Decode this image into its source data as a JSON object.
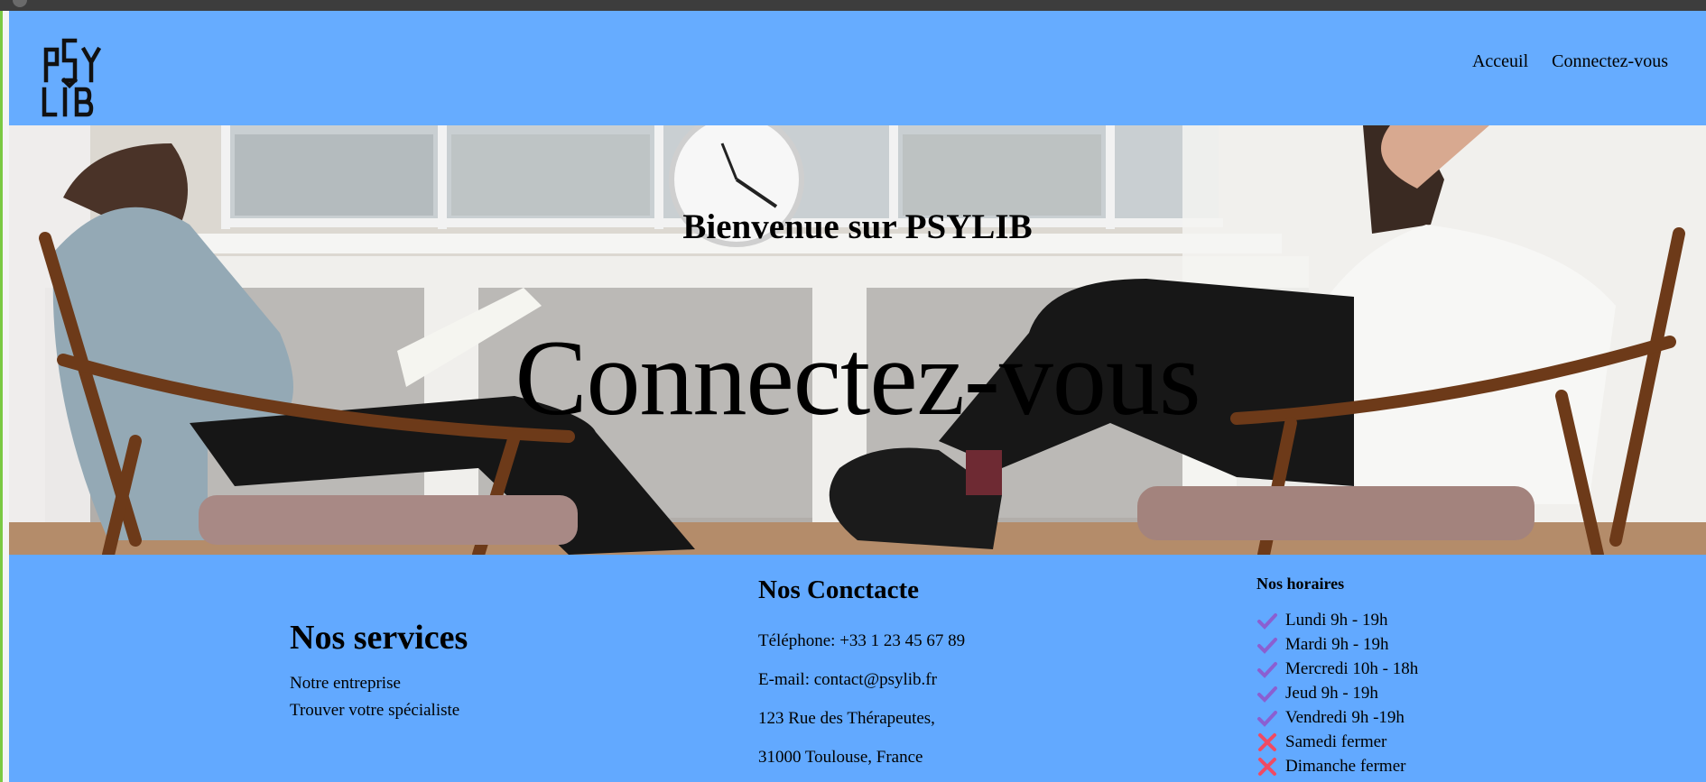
{
  "header": {
    "logo_text": "PSY LIB",
    "nav": [
      {
        "label": "Acceuil"
      },
      {
        "label": "Connectez-vous"
      }
    ]
  },
  "hero": {
    "subtitle": "Bienvenue sur PSYLIB",
    "title": "Connectez-vous"
  },
  "footer": {
    "services": {
      "title": "Nos services",
      "links": [
        "Notre entreprise",
        "Trouver votre spécialiste"
      ]
    },
    "contact": {
      "title": "Nos Conctacte",
      "phone": "Téléphone: +33 1 23 45 67 89",
      "email": "E-mail: contact@psylib.fr",
      "address1": "123 Rue des Thérapeutes,",
      "address2": "31000 Toulouse, France"
    },
    "hours": {
      "title": "Nos horaires",
      "days": [
        {
          "label": "Lundi 9h - 19h",
          "icon": "check-icon"
        },
        {
          "label": "Mardi 9h - 19h",
          "icon": "check-icon"
        },
        {
          "label": "Mercredi 10h - 18h",
          "icon": "check-icon"
        },
        {
          "label": "Jeud 9h - 19h",
          "icon": "check-icon"
        },
        {
          "label": "Vendredi 9h -19h",
          "icon": "check-icon"
        },
        {
          "label": "Samedi fermer",
          "icon": "cross-icon"
        },
        {
          "label": "Dimanche fermer",
          "icon": "cross-icon"
        }
      ]
    }
  },
  "colors": {
    "header_bg": "#66acff",
    "footer_bg": "#62a9ff",
    "check": "#8b5fd1",
    "cross": "#f04a63"
  }
}
